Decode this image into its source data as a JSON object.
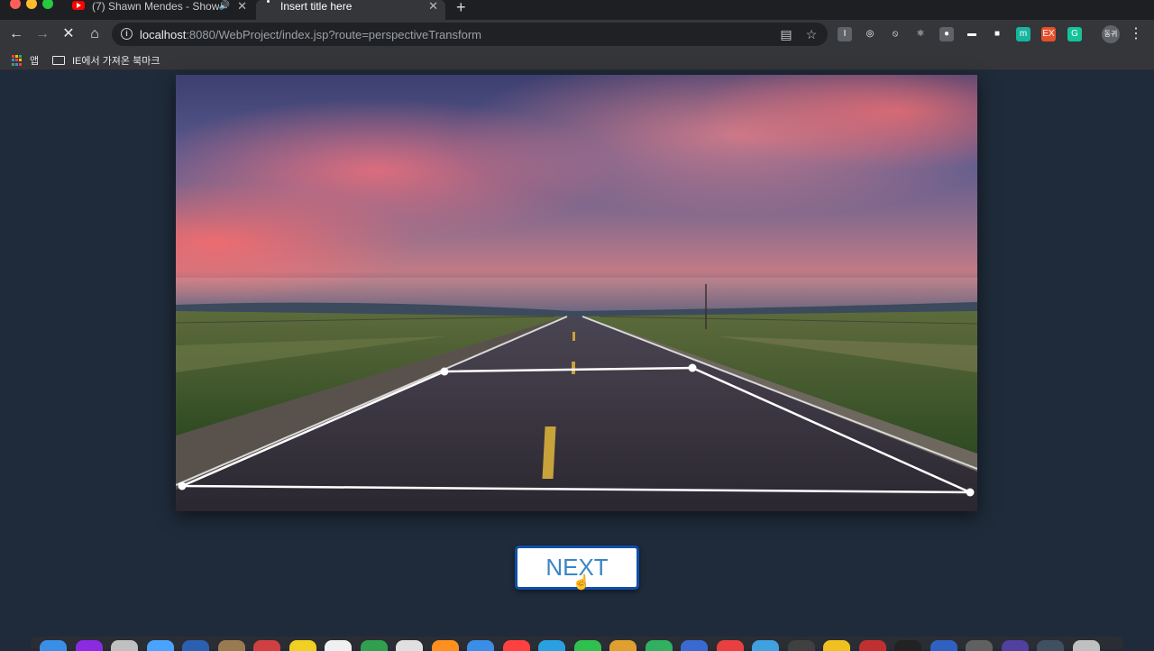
{
  "browser": {
    "tabs": [
      {
        "title": "(7) Shawn Mendes - Show",
        "audio": "🔊"
      },
      {
        "title": "Insert title here"
      }
    ],
    "new_tab": "+",
    "tab_close": "✕",
    "url_host": "localhost",
    "url_rest": ":8080/WebProject/index.jsp?route=perspectiveTransform",
    "bookmarks": [
      {
        "label": "앱"
      },
      {
        "label": "IE에서 가져온 북마크"
      }
    ],
    "profile_label": "동귀",
    "extensions": [
      {
        "name": "extension-i-icon",
        "label": "I",
        "color": "#5f6368"
      },
      {
        "name": "extension-target-icon",
        "label": "◎",
        "color": "#35363a"
      },
      {
        "name": "extension-block-icon",
        "label": "⦸",
        "color": "#35363a"
      },
      {
        "name": "extension-react-icon",
        "label": "⚛",
        "color": "#35363a"
      },
      {
        "name": "extension-circle-icon",
        "label": "●",
        "color": "#5f6368"
      },
      {
        "name": "extension-card-icon",
        "label": "▬",
        "color": "#35363a"
      },
      {
        "name": "extension-square-icon",
        "label": "■",
        "color": "#35363a"
      },
      {
        "name": "extension-m-icon",
        "label": "m",
        "color": "#16b5a0"
      },
      {
        "name": "extension-ex-icon",
        "label": "EX",
        "color": "#e5502b"
      },
      {
        "name": "extension-grammarly-icon",
        "label": "G",
        "color": "#15c39a"
      }
    ]
  },
  "colors": {
    "page_background": "#1f2b3a",
    "button_border": "#0f4fa8",
    "button_text": "#3b86c4",
    "overlay_line": "#ffffff"
  },
  "editor": {
    "image_subject": "road-under-sunset-sky",
    "perspective_points": [
      {
        "id": "top-left"
      },
      {
        "id": "top-right"
      },
      {
        "id": "bottom-right"
      },
      {
        "id": "bottom-left"
      }
    ]
  },
  "actions": {
    "next_label": "NEXT"
  }
}
